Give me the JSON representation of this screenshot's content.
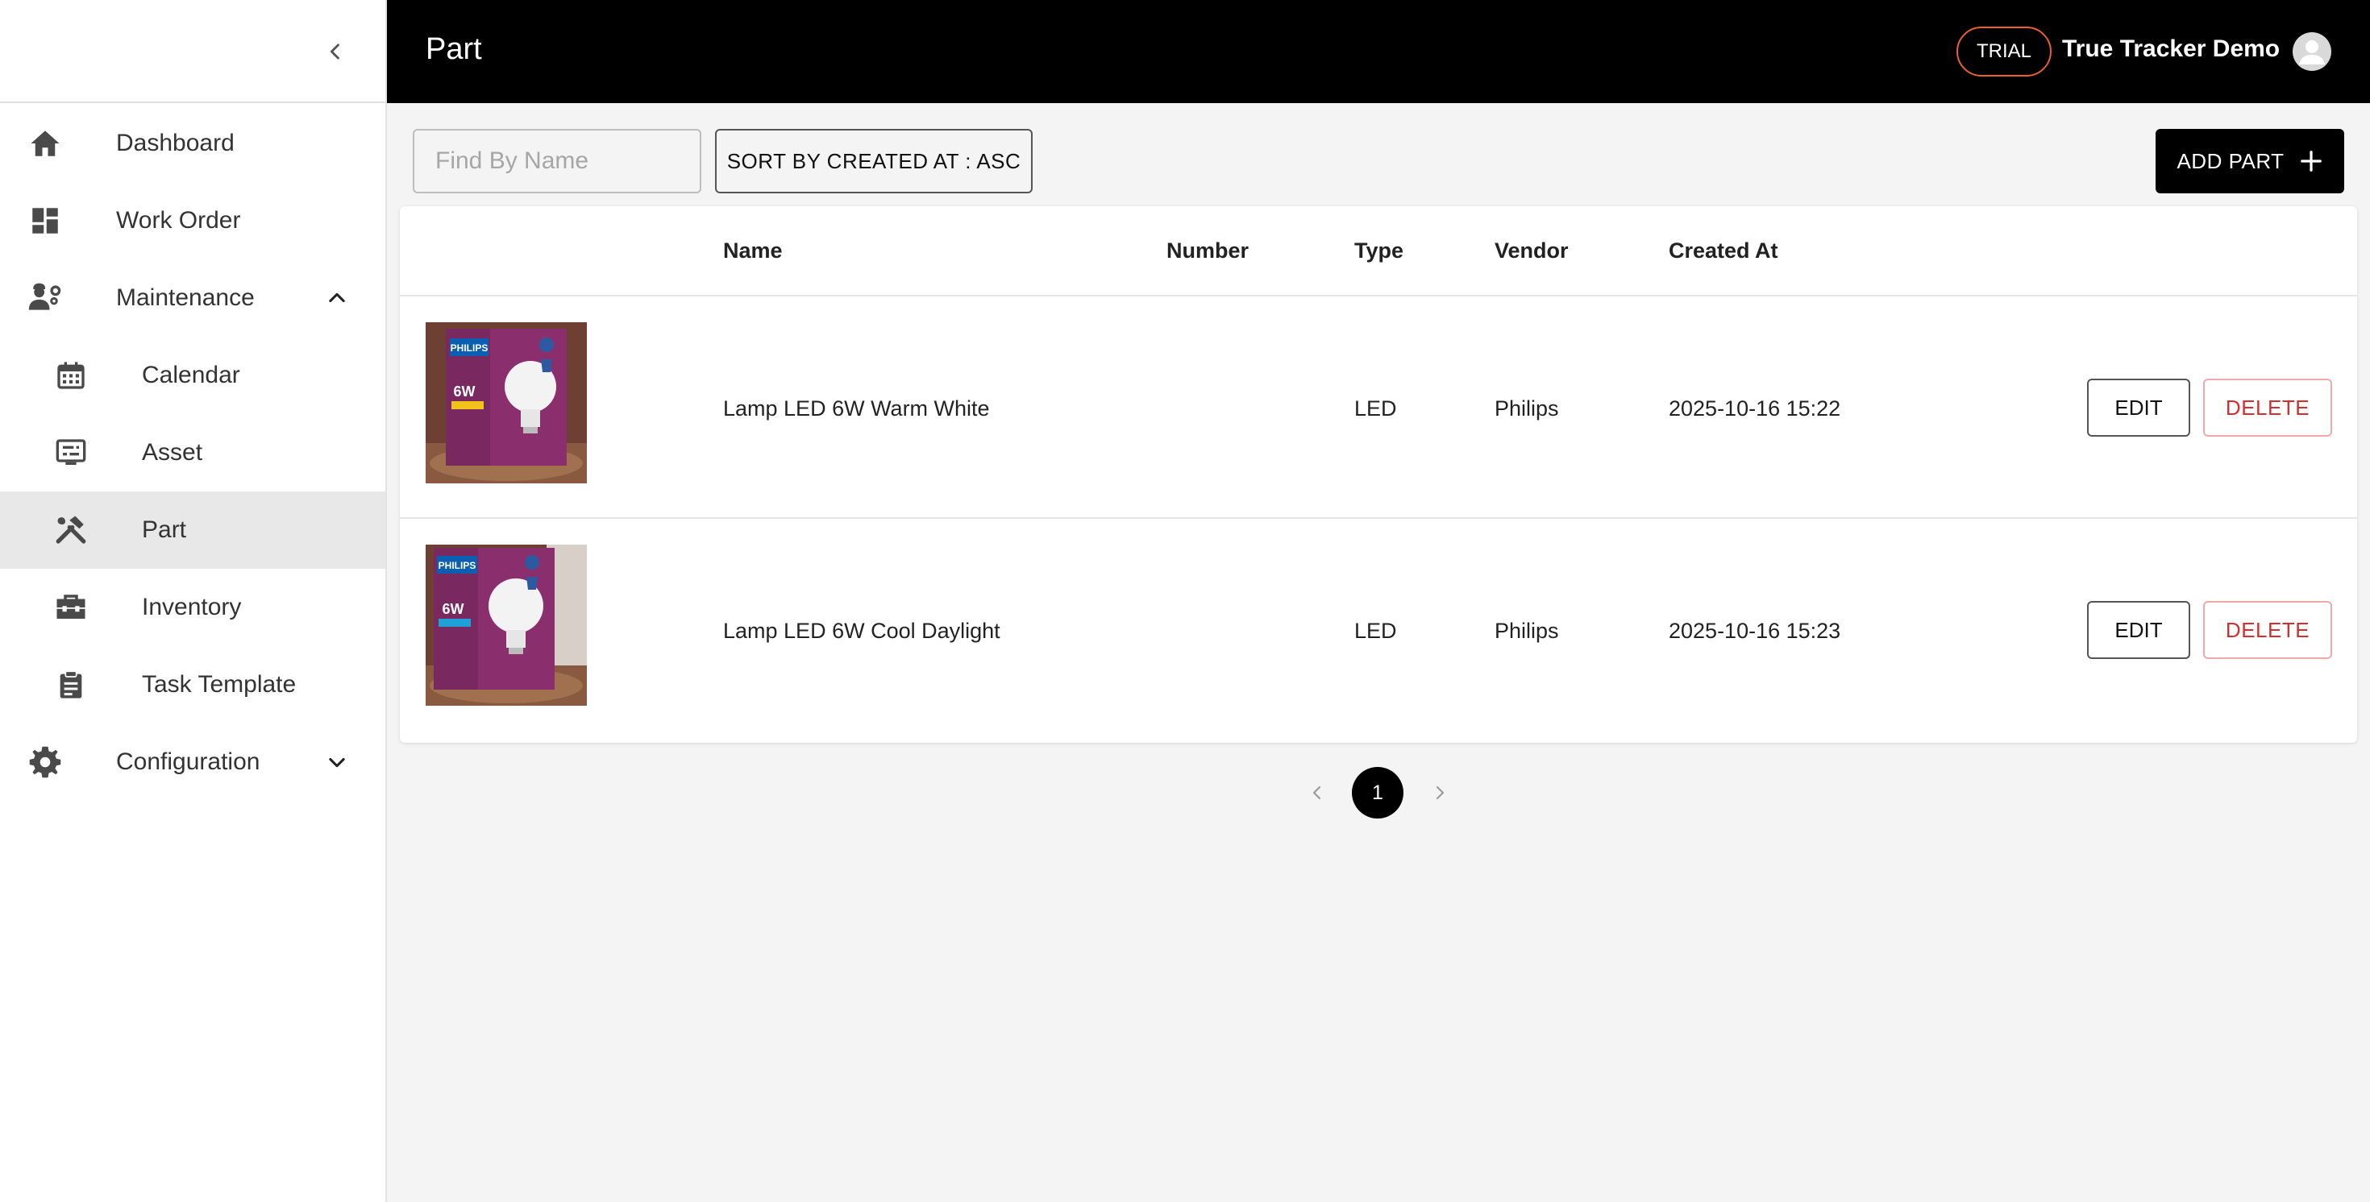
{
  "sidebar": {
    "items": [
      {
        "label": "Dashboard",
        "icon": "home-icon"
      },
      {
        "label": "Work Order",
        "icon": "dashboard-icon"
      },
      {
        "label": "Maintenance",
        "icon": "engineer-icon",
        "expanded": true
      },
      {
        "label": "Calendar",
        "icon": "calendar-icon"
      },
      {
        "label": "Asset",
        "icon": "asset-icon"
      },
      {
        "label": "Part",
        "icon": "tools-icon",
        "active": true
      },
      {
        "label": "Inventory",
        "icon": "toolbox-icon"
      },
      {
        "label": "Task Template",
        "icon": "clipboard-icon"
      },
      {
        "label": "Configuration",
        "icon": "gear-icon",
        "expanded": false
      }
    ]
  },
  "header": {
    "title": "Part",
    "trial_label": "TRIAL",
    "user_name": "True Tracker Demo",
    "trial_color": "#e8622a"
  },
  "toolbar": {
    "search_placeholder": "Find By Name",
    "sort_label": "SORT BY CREATED AT : ASC",
    "add_label": "ADD PART"
  },
  "table": {
    "columns": [
      "Name",
      "Number",
      "Type",
      "Vendor",
      "Created At"
    ],
    "rows": [
      {
        "name": "Lamp LED 6W Warm White",
        "number": "",
        "type": "LED",
        "vendor": "Philips",
        "created_at": "2025-10-16 15:22",
        "edit_label": "EDIT",
        "delete_label": "DELETE",
        "image_brand": "PHILIPS",
        "image_wattage": "6W"
      },
      {
        "name": "Lamp LED 6W Cool Daylight",
        "number": "",
        "type": "LED",
        "vendor": "Philips",
        "created_at": "2025-10-16 15:23",
        "edit_label": "EDIT",
        "delete_label": "DELETE",
        "image_brand": "PHILIPS",
        "image_wattage": "6W"
      }
    ]
  },
  "pagination": {
    "current_page": "1"
  },
  "colors": {
    "header_bg": "#000000",
    "delete": "#d32f2f",
    "active_nav": "#e8e8e8"
  }
}
